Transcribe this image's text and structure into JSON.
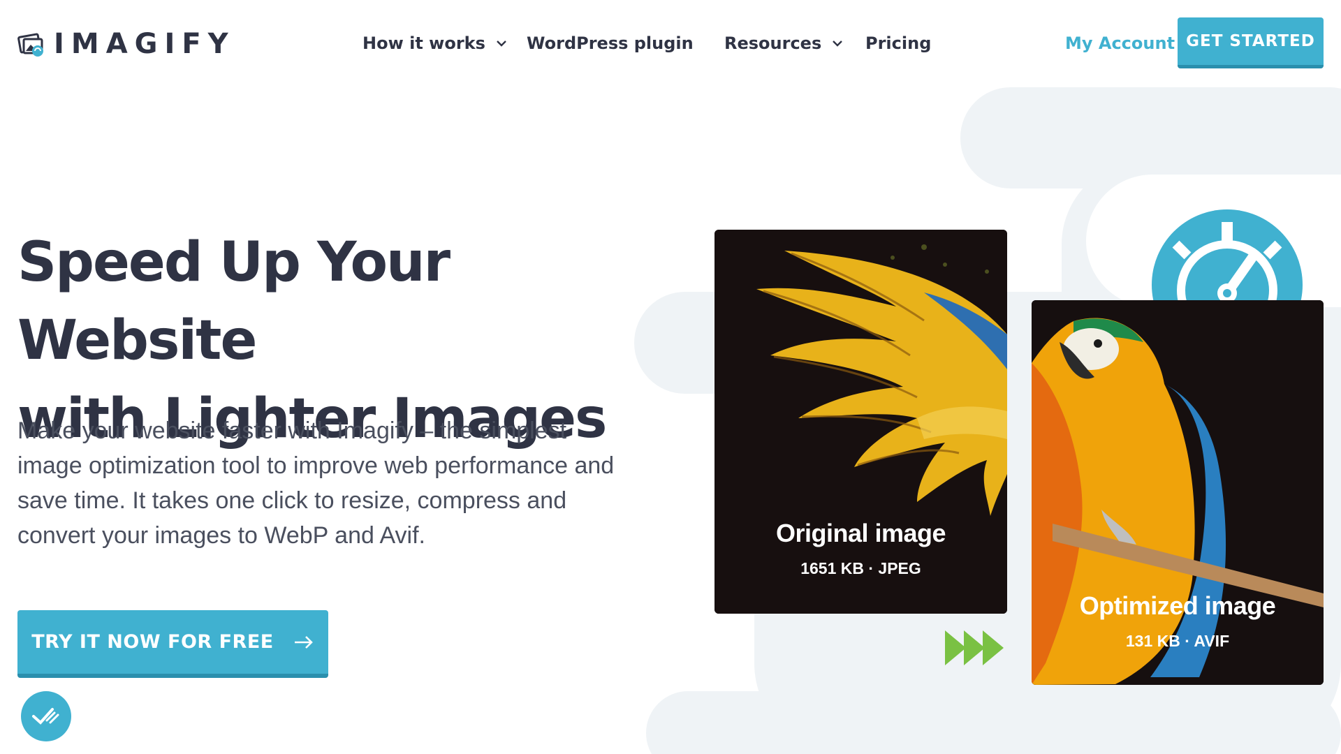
{
  "brand": {
    "name": "IMAGIFY",
    "accent": "#40b1d0",
    "text_color": "#2f3344",
    "logo_icon": "imagify-logo-icon"
  },
  "nav": {
    "items": [
      {
        "label": "How it works",
        "has_dropdown": true
      },
      {
        "label": "WordPress plugin",
        "has_dropdown": false
      },
      {
        "label": "Resources",
        "has_dropdown": true
      },
      {
        "label": "Pricing",
        "has_dropdown": false
      }
    ],
    "my_account": "My Account",
    "cta": "GET STARTED"
  },
  "hero": {
    "title_line1": "Speed Up Your Website",
    "title_line2": "with Lighter Images",
    "description": "Make your website faster with Imagify – the simplest image optimization tool to improve web performance and save time. It takes one click to resize, compress and convert your images to WebP and Avif.",
    "cta": "TRY IT NOW FOR FREE",
    "cta_icon": "arrow-right-icon"
  },
  "comparison": {
    "original": {
      "title": "Original image",
      "size": "1651 KB · JPEG"
    },
    "optimized": {
      "title": "Optimized image",
      "size": "131 KB · AVIF"
    },
    "arrow_icon": "fast-forward-icon",
    "arrow_color": "#7ac143",
    "speed_icon": "speedometer-icon"
  },
  "badge_icon": "checkmark-badge-icon"
}
